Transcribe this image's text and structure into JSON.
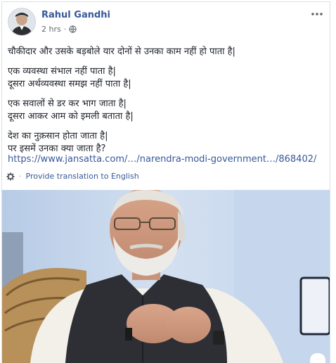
{
  "post": {
    "author": "Rahul Gandhi",
    "timestamp": "2 hrs",
    "audience_icon": "globe-icon",
    "paragraphs": [
      [
        "चौकीदार और उसके बड़बोले यार दोनों से उनका काम नहीं हो पाता है|"
      ],
      [
        "एक व्यवस्था संभाल नहीं पाता है|",
        "दूसरा अर्थव्यवस्था समझ नहीं पाता है|"
      ],
      [
        "एक सवालों से डर कर भाग जाता है|",
        "दूसरा आकर आम को इमली बताता है|"
      ],
      [
        "देश का नुक़सान होता जाता है|",
        "पर इसमें उनका क्या जाता है?"
      ]
    ],
    "link": "https://www.jansatta.com/…/narendra-modi-government…/868402/",
    "translate_label": "Provide translation to English",
    "translate_icon": "gear-icon",
    "photo_alt": "photo"
  },
  "colors": {
    "link": "#365899",
    "text": "#1d2129",
    "meta": "#616770"
  }
}
